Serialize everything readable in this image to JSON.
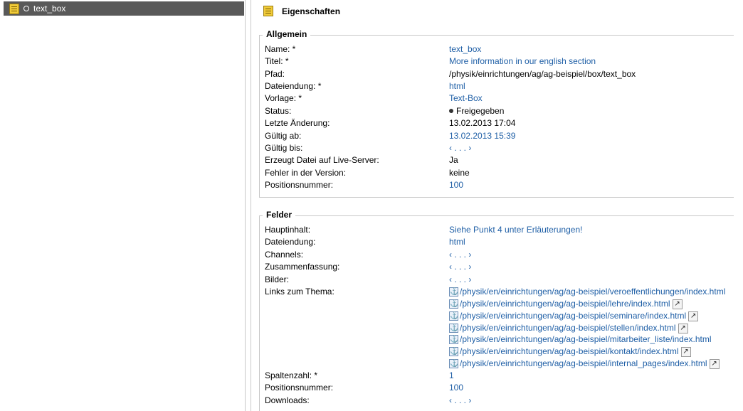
{
  "tree": {
    "item_label": "text_box"
  },
  "panel": {
    "title": "Eigenschaften",
    "allgemein": {
      "legend": "Allgemein",
      "rows": [
        {
          "label": "Name: *",
          "value": "text_box"
        },
        {
          "label": "Titel: *",
          "value": "More information in our english section"
        },
        {
          "label": "Pfad:",
          "value": "/physik/einrichtungen/ag/ag-beispiel/box/text_box"
        },
        {
          "label": "Dateiendung: *",
          "value": "html"
        },
        {
          "label": "Vorlage: *",
          "value": "Text-Box"
        },
        {
          "label": "Status:",
          "value": "Freigegeben"
        },
        {
          "label": "Letzte Änderung:",
          "value": "13.02.2013 17:04"
        },
        {
          "label": "Gültig ab:",
          "value": "13.02.2013 15:39"
        },
        {
          "label": "Gültig bis:",
          "value": "‹ . . . ›"
        },
        {
          "label": "Erzeugt Datei auf Live-Server:",
          "value": "Ja"
        },
        {
          "label": "Fehler in der Version:",
          "value": "keine"
        },
        {
          "label": "Positionsnummer:",
          "value": "100"
        }
      ]
    },
    "felder": {
      "legend": "Felder",
      "rows": [
        {
          "label": "Hauptinhalt:",
          "value": "Siehe Punkt 4 unter Erläuterungen!"
        },
        {
          "label": "Dateiendung:",
          "value": "html"
        },
        {
          "label": "Channels:",
          "value": "‹ . . . ›"
        },
        {
          "label": "Zusammenfassung:",
          "value": "‹ . . . ›"
        },
        {
          "label": "Bilder:",
          "value": "‹ . . . ›"
        },
        {
          "label": "Links zum Thema:"
        }
      ],
      "links": [
        "/physik/en/einrichtungen/ag/ag-beispiel/veroeffentlichungen/index.html",
        "/physik/en/einrichtungen/ag/ag-beispiel/lehre/index.html",
        "/physik/en/einrichtungen/ag/ag-beispiel/seminare/index.html",
        "/physik/en/einrichtungen/ag/ag-beispiel/stellen/index.html",
        "/physik/en/einrichtungen/ag/ag-beispiel/mitarbeiter_liste/index.html",
        "/physik/en/einrichtungen/ag/ag-beispiel/kontakt/index.html",
        "/physik/en/einrichtungen/ag/ag-beispiel/internal_pages/index.html"
      ],
      "after_rows": [
        {
          "label": "Spaltenzahl: *",
          "value": "1"
        },
        {
          "label": "Positionsnummer:",
          "value": "100"
        },
        {
          "label": "Downloads:",
          "value": "‹ . . . ›"
        }
      ]
    }
  },
  "icons": {
    "document": "document-icon",
    "anchor": "anchor-icon",
    "external": "external-link-icon"
  },
  "colors": {
    "link": "#1f5fa6",
    "selected_row": "#595959"
  }
}
